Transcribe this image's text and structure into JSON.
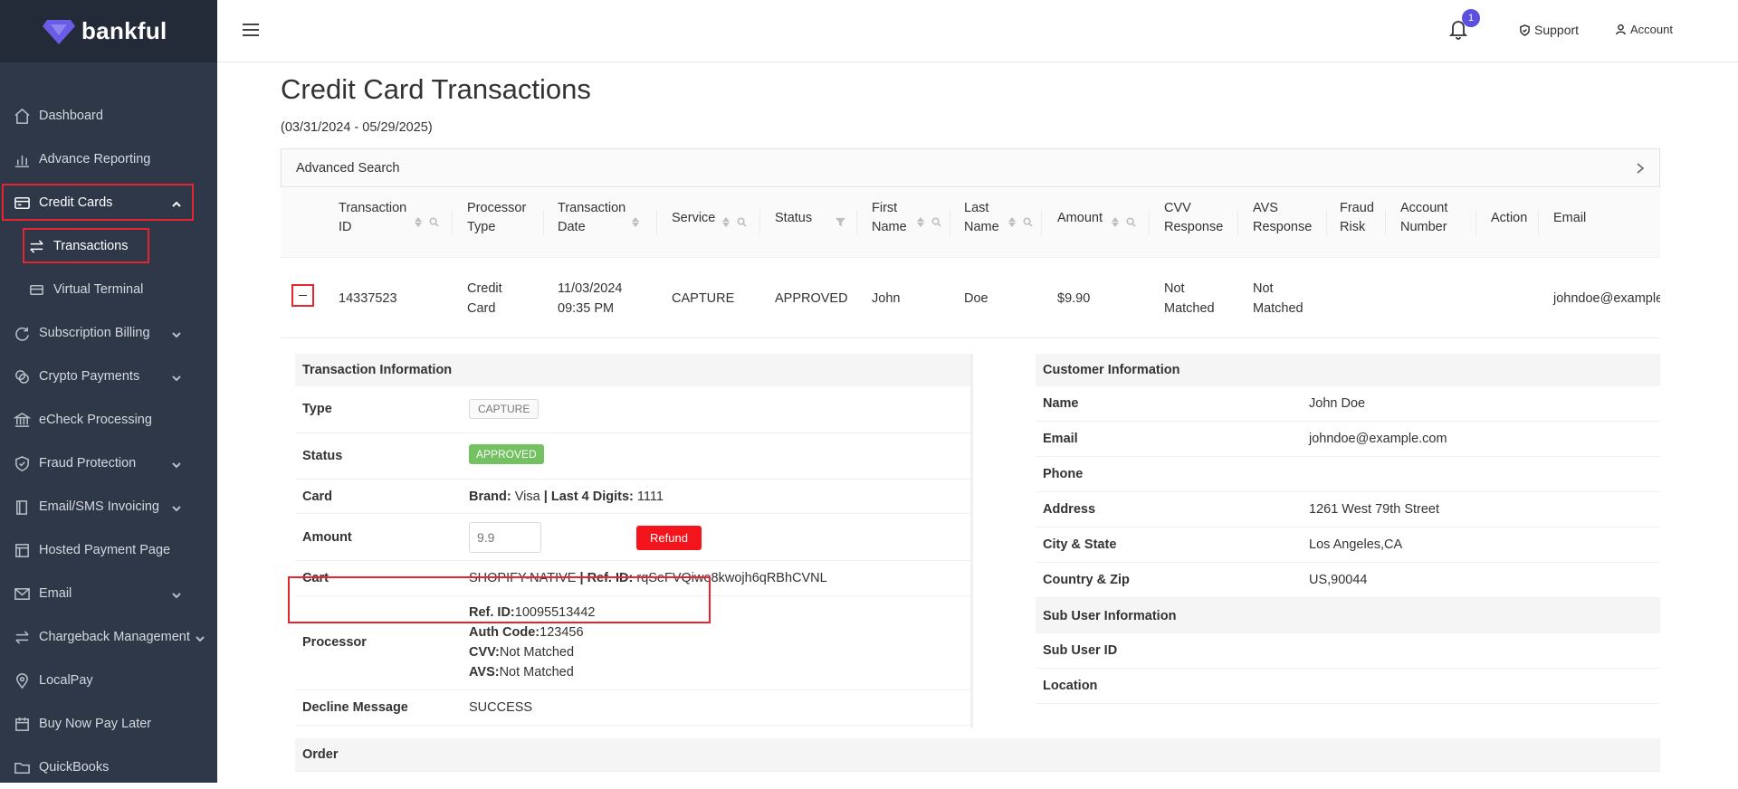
{
  "app": {
    "brand": "bankful",
    "brand_color": "#5b4fe0",
    "highlight_color": "#e5262e"
  },
  "sidebar": {
    "items": [
      {
        "label": "Dashboard",
        "icon": "home-icon"
      },
      {
        "label": "Advance Reporting",
        "icon": "bar-chart-icon"
      },
      {
        "label": "Credit Cards",
        "icon": "credit-card-icon",
        "expanded": true
      },
      {
        "label": "Transactions",
        "icon": "swap-icon"
      },
      {
        "label": "Virtual Terminal",
        "icon": "card-terminal-icon"
      },
      {
        "label": "Subscription Billing",
        "icon": "refresh-icon"
      },
      {
        "label": "Crypto Payments",
        "icon": "coins-icon"
      },
      {
        "label": "eCheck Processing",
        "icon": "bank-icon"
      },
      {
        "label": "Fraud Protection",
        "icon": "shield-icon"
      },
      {
        "label": "Email/SMS Invoicing",
        "icon": "book-icon"
      },
      {
        "label": "Hosted Payment Page",
        "icon": "page-icon"
      },
      {
        "label": "Email",
        "icon": "mail-icon"
      },
      {
        "label": "Chargeback Management",
        "icon": "swap-icon"
      },
      {
        "label": "LocalPay",
        "icon": "location-icon"
      },
      {
        "label": "Buy Now Pay Later",
        "icon": "calendar-icon"
      },
      {
        "label": "QuickBooks",
        "icon": "folder-icon"
      }
    ]
  },
  "topbar": {
    "notification_count": "1",
    "support_label": "Support",
    "account_label": "Account"
  },
  "page": {
    "title": "Credit Card Transactions",
    "date_range": "(03/31/2024 - 05/29/2025)",
    "advanced_search": "Advanced Search"
  },
  "table": {
    "headers": [
      {
        "line1": "Transaction",
        "line2": "ID"
      },
      {
        "line1": "Processor",
        "line2": "Type"
      },
      {
        "line1": "Transaction",
        "line2": "Date"
      },
      {
        "line1": "Service",
        "line2": ""
      },
      {
        "line1": "Status",
        "line2": ""
      },
      {
        "line1": "First",
        "line2": "Name"
      },
      {
        "line1": "Last",
        "line2": "Name"
      },
      {
        "line1": "Amount",
        "line2": ""
      },
      {
        "line1": "CVV",
        "line2": "Response"
      },
      {
        "line1": "AVS",
        "line2": "Response"
      },
      {
        "line1": "Fraud",
        "line2": "Risk"
      },
      {
        "line1": "Account",
        "line2": "Number"
      },
      {
        "line1": "Action",
        "line2": ""
      },
      {
        "line1": "Email",
        "line2": ""
      }
    ],
    "row": {
      "transaction_id": "14337523",
      "processor_type_1": "Credit",
      "processor_type_2": "Card",
      "date_1": "11/03/2024",
      "date_2": "09:35 PM",
      "service": "CAPTURE",
      "status": "APPROVED",
      "first_name": "John",
      "last_name": "Doe",
      "amount": "$9.90",
      "cvv_1": "Not",
      "cvv_2": "Matched",
      "avs_1": "Not",
      "avs_2": "Matched",
      "email": "johndoe@example"
    }
  },
  "transaction_info": {
    "title": "Transaction Information",
    "type_label": "Type",
    "type_value": "CAPTURE",
    "status_label": "Status",
    "status_value": "APPROVED",
    "card_label": "Card",
    "brand_label": "Brand:",
    "brand_value": "Visa",
    "last4_label": "| Last 4 Digits:",
    "last4_value": "1111",
    "amount_label": "Amount",
    "amount_value": "9.9",
    "refund_label": "Refund",
    "cart_label": "Cart",
    "cart_value": "SHOPIFY-NATIVE",
    "cart_ref_label": "| Ref. ID:",
    "cart_ref_value": "rqSeFVQiwe8kwojh6qRBhCVNL",
    "processor_label": "Processor",
    "ref_label": "Ref. ID:",
    "ref_value": "10095513442",
    "auth_label": "Auth Code:",
    "auth_value": "123456",
    "cvv_label": "CVV:",
    "cvv_value": "Not Matched",
    "avs_label": "AVS:",
    "avs_value": "Not Matched",
    "decline_label": "Decline Message",
    "decline_value": "SUCCESS"
  },
  "customer_info": {
    "title": "Customer Information",
    "name_label": "Name",
    "name_value": "John Doe",
    "email_label": "Email",
    "email_value": "johndoe@example.com",
    "phone_label": "Phone",
    "phone_value": "",
    "address_label": "Address",
    "address_value": "1261 West 79th Street",
    "city_label": "City & State",
    "city_value": "Los Angeles,CA",
    "country_label": "Country & Zip",
    "country_value": "US,90044",
    "sub_title": "Sub User Information",
    "subuser_label": "Sub User ID",
    "subuser_value": "",
    "location_label": "Location",
    "location_value": ""
  },
  "order": {
    "title": "Order"
  }
}
